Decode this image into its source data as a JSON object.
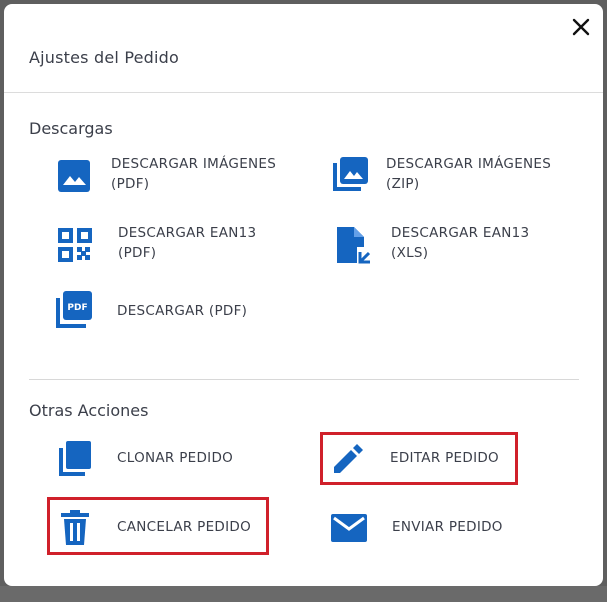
{
  "modal": {
    "title": "Ajustes del Pedido",
    "close_icon": "close-icon"
  },
  "downloads": {
    "title": "Descargas",
    "items": [
      {
        "line1": "DESCARGAR IMÁGENES",
        "line2": "(PDF)",
        "icon": "image-icon"
      },
      {
        "line1": "DESCARGAR IMÁGENES",
        "line2": "(ZIP)",
        "icon": "image-stack-icon"
      },
      {
        "line1": "DESCARGAR EAN13",
        "line2": "(PDF)",
        "icon": "qr-code-icon"
      },
      {
        "line1": "DESCARGAR EAN13",
        "line2": "(XLS)",
        "icon": "file-arrow-icon"
      },
      {
        "line1": "DESCARGAR (PDF)",
        "icon": "pdf-file-icon"
      }
    ]
  },
  "other_actions": {
    "title": "Otras Acciones",
    "items": [
      {
        "label": "CLONAR PEDIDO",
        "icon": "copy-icon"
      },
      {
        "label": "EDITAR PEDIDO",
        "icon": "pencil-icon"
      },
      {
        "label": "CANCELAR PEDIDO",
        "icon": "trash-icon"
      },
      {
        "label": "ENVIAR PEDIDO",
        "icon": "envelope-icon"
      }
    ]
  },
  "colors": {
    "icon_blue": "#1565c0",
    "highlight_red": "#d0202a",
    "text": "#3b3f4a"
  }
}
